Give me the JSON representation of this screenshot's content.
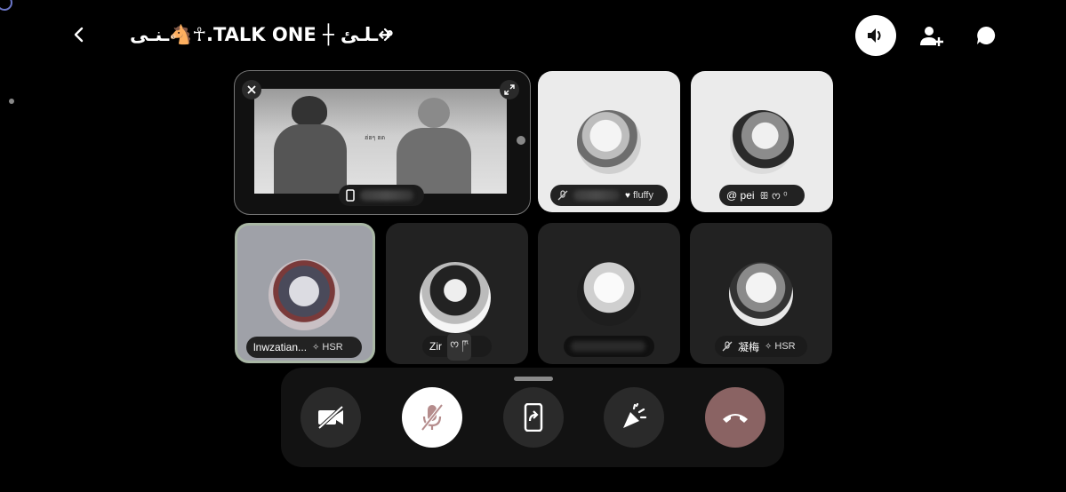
{
  "header": {
    "title": "ـنـى🐴☥.TALK ONE ┼ ـلـئ↫",
    "back_icon": "chevron-left-icon",
    "next_icon": "chevron-right-icon",
    "speaker_icon": "speaker-icon",
    "add_member_icon": "person-add-icon",
    "chat_icon": "chat-bubble-icon"
  },
  "stream": {
    "close_icon": "close-icon",
    "expand_icon": "expand-icon",
    "device_icon": "phone-icon",
    "caption": "ฮ่ฮๆ ฮต"
  },
  "participants": [
    {
      "id": "p1",
      "name": "",
      "activity": "fluffy",
      "activity_icon": "heart-icon",
      "muted": true
    },
    {
      "id": "p2",
      "name": "@  pei",
      "activity": "ꕥ ᰔ ⁰",
      "muted": false
    },
    {
      "id": "p3",
      "name": "lnwzatian...",
      "activity": "HSR",
      "activity_icon": "sparkle-icon",
      "muted": false,
      "speaking": true
    },
    {
      "id": "p4",
      "name": "Zir",
      "activity": "ᰔ ཫ",
      "muted": false
    },
    {
      "id": "p5",
      "name": "",
      "activity": "",
      "muted": false
    },
    {
      "id": "p6",
      "name": "凝梅",
      "activity": "HSR",
      "activity_icon": "sparkle-icon",
      "muted": true
    }
  ],
  "controls": {
    "camera_icon": "camera-off-icon",
    "mic_icon": "mic-off-icon",
    "share_icon": "screen-share-icon",
    "soundboard_icon": "soundboard-icon",
    "hangup_icon": "hang-up-icon",
    "accent_hangup": "#8a6363",
    "accent_mic": "#ffffff"
  }
}
